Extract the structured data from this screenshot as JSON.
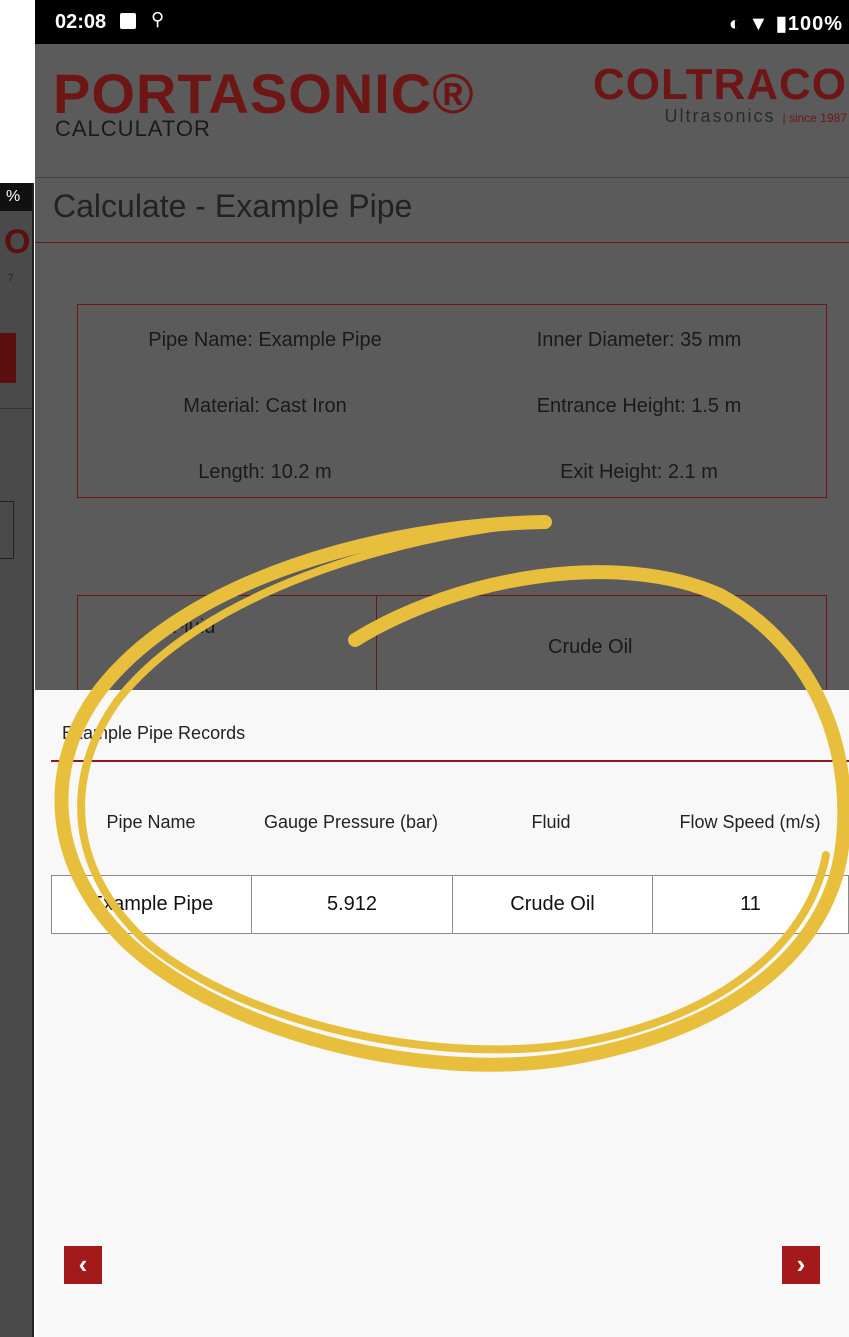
{
  "status": {
    "time": "02:08",
    "battery": "100%"
  },
  "brand": {
    "name": "PORTASONIC®",
    "subtitle": "CALCULATOR",
    "partner": "COLTRACO",
    "partner_sub": "Ultrasonics",
    "since": "| since 1987"
  },
  "page": {
    "title": "Calculate - Example Pipe"
  },
  "pipe_info": {
    "pipe_name": "Pipe Name: Example Pipe",
    "inner_diameter": "Inner Diameter: 35 mm",
    "material": "Material: Cast Iron",
    "entrance_height": "Entrance Height: 1.5 m",
    "length": "Length: 10.2 m",
    "exit_height": "Exit Height: 2.1 m"
  },
  "fluid_table": {
    "label": "Fluid",
    "value": "Crude Oil"
  },
  "records": {
    "title": "Example Pipe Records",
    "headers": [
      "Pipe Name",
      "Gauge Pressure (bar)",
      "Fluid",
      "Flow Speed (m/s)"
    ],
    "row": [
      "Example Pipe",
      "5.912",
      "Crude Oil",
      "11"
    ]
  },
  "nav": {
    "prev": "‹",
    "next": "›"
  },
  "background_phone": {
    "status": "%",
    "logo": "O",
    "since": "7"
  },
  "colors": {
    "brand_red": "#6e1616",
    "accent_red": "#a31a1a",
    "highlight": "#e8bf3c"
  },
  "icons": [
    "image-icon",
    "usb-icon",
    "data-saver-icon",
    "wifi-icon",
    "battery-icon",
    "chevron-left-icon",
    "chevron-right-icon"
  ]
}
